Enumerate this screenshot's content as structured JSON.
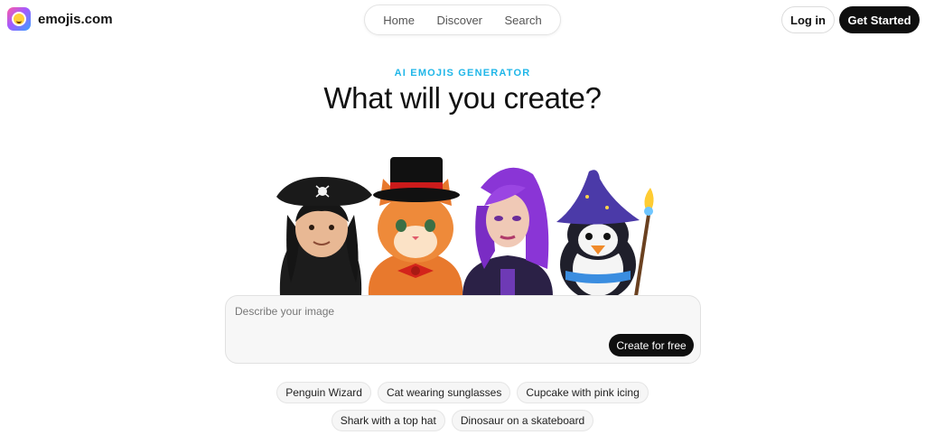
{
  "header": {
    "logo_text": "emojis.com",
    "nav": [
      {
        "label": "Home"
      },
      {
        "label": "Discover"
      },
      {
        "label": "Search"
      }
    ],
    "login_label": "Log in",
    "get_started_label": "Get Started"
  },
  "hero": {
    "eyebrow": "AI EMOJIS GENERATOR",
    "headline": "What will you create?"
  },
  "prompt": {
    "placeholder": "Describe your image",
    "value": "",
    "submit_label": "Create for free"
  },
  "suggestions": {
    "row1": [
      "Penguin Wizard",
      "Cat wearing sunglasses",
      "Cupcake with pink icing"
    ],
    "row2": [
      "Shark with a top hat",
      "Dinosaur on a skateboard"
    ]
  },
  "colors": {
    "accent": "#1fb6e8",
    "button_dark": "#0f0f0f"
  },
  "icons": {
    "logo": "emoji-smile-icon",
    "characters": [
      "pirate-character",
      "cat-top-hat-character",
      "purple-hair-woman-character",
      "penguin-wizard-character"
    ]
  }
}
